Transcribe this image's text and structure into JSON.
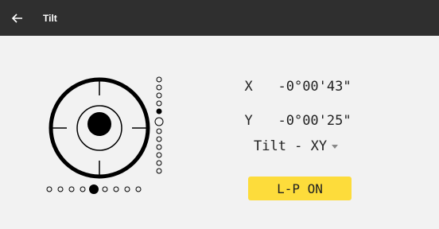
{
  "appbar": {
    "title": "Tilt",
    "back_icon": "arrow-left-icon",
    "background": "#2f2f2f"
  },
  "readouts": {
    "x": {
      "label": "X",
      "value": "-0°00'43\""
    },
    "y": {
      "label": "Y",
      "value": "-0°00'25\""
    }
  },
  "mode": {
    "selected": "Tilt - XY",
    "icon": "dropdown-caret-icon"
  },
  "laser_button": {
    "label": "L-P ON",
    "color": "#fddc3b"
  },
  "level": {
    "horizontal_scale": {
      "count": 9,
      "filled_index": 4
    },
    "vertical_scale": {
      "count": 12,
      "filled_index": 4,
      "open_index": 5
    }
  }
}
